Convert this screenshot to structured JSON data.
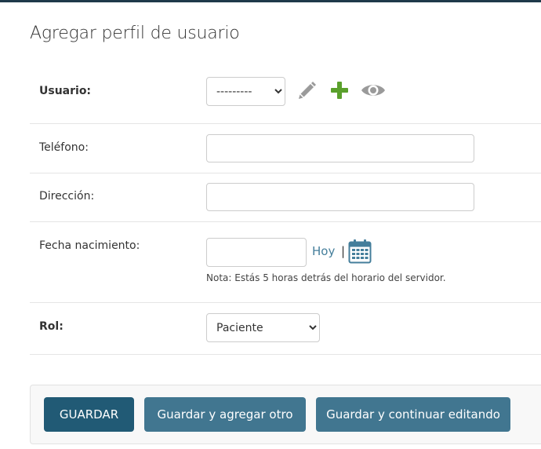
{
  "page": {
    "title": "Agregar perfil de usuario"
  },
  "form": {
    "usuario": {
      "label": "Usuario:",
      "selected": "---------",
      "options": [
        "---------"
      ],
      "actions": [
        "pencil-icon",
        "plus-icon",
        "eye-icon"
      ]
    },
    "telefono": {
      "label": "Teléfono:",
      "value": ""
    },
    "direccion": {
      "label": "Dirección:",
      "value": ""
    },
    "fecha_nacimiento": {
      "label": "Fecha nacimiento:",
      "value": "",
      "today_link": "Hoy",
      "separator": "|",
      "help": "Nota: Estás 5 horas detrás del horario del servidor."
    },
    "rol": {
      "label": "Rol:",
      "selected": "Paciente",
      "options": [
        "Paciente"
      ]
    }
  },
  "buttons": {
    "save": "GUARDAR",
    "save_add_another": "Guardar y agregar otro",
    "save_continue": "Guardar y continuar editando"
  },
  "colors": {
    "link": "#447e9b",
    "primary_button": "#215a75",
    "secondary_button": "#417690",
    "add_icon": "#5aa02c"
  }
}
